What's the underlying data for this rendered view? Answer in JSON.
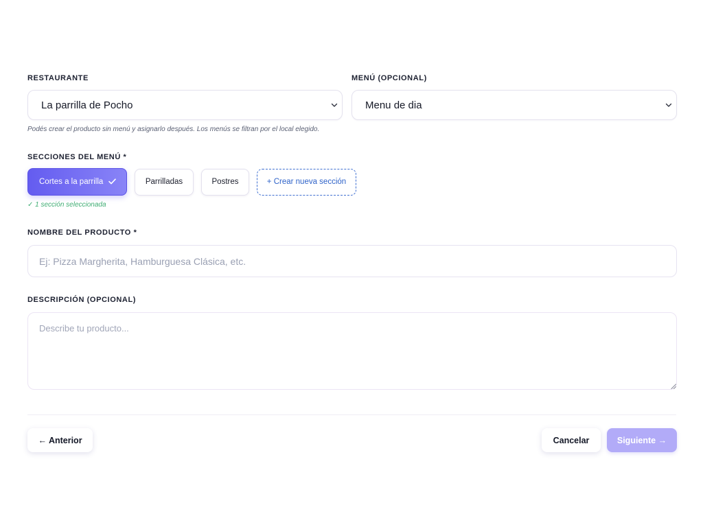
{
  "form": {
    "restaurant": {
      "label": "RESTAURANTE",
      "value": "La parrilla de Pocho"
    },
    "menu": {
      "label": "MENÚ (OPCIONAL)",
      "value": "Menu de dia"
    },
    "helper": "Podés crear el producto sin menú y asignarlo después. Los menús se filtran por el local elegido.",
    "sections": {
      "label": "SECCIONES DEL MENÚ *",
      "chips": [
        {
          "label": "Cortes a la parrilla",
          "selected": true
        },
        {
          "label": "Parrilladas",
          "selected": false
        },
        {
          "label": "Postres",
          "selected": false
        }
      ],
      "create_label": "+ Crear nueva sección",
      "status": "✓ 1 sección seleccionada"
    },
    "product_name": {
      "label": "NOMBRE DEL PRODUCTO *",
      "value": "",
      "placeholder": "Ej: Pizza Margherita, Hamburguesa Clásica, etc."
    },
    "description": {
      "label": "DESCRIPCIÓN (OPCIONAL)",
      "value": "",
      "placeholder": "Describe tu producto..."
    }
  },
  "actions": {
    "back_label": "← Anterior",
    "cancel_label": "Cancelar",
    "next_label": "Siguiente →",
    "next_enabled": false
  },
  "icons": {
    "select_chevron": "chevron-down-icon",
    "chip_selected": "checkmark-icon",
    "textarea_resize": "resize-handle-icon"
  },
  "colors": {
    "accent": "#645cf0",
    "accent_light": "#8984f7",
    "next_disabled": "#b2abf8",
    "success": "#40ad74",
    "link": "#2f63c9",
    "border": "#e4e2ee"
  }
}
